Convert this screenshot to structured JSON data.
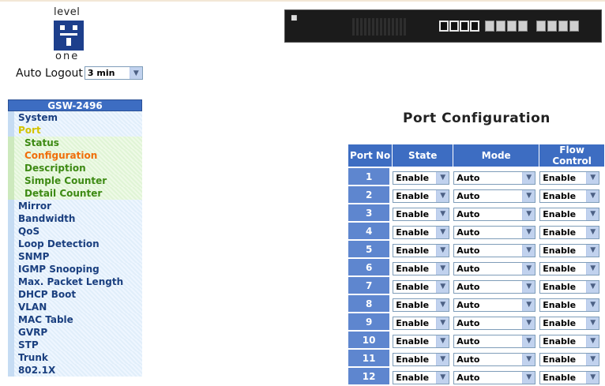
{
  "logo": {
    "top_text": "level",
    "bottom_text": "one"
  },
  "auto_logout": {
    "label": "Auto Logout",
    "value": "3 min"
  },
  "menu": {
    "title": "GSW-2496",
    "items": [
      {
        "label": "System",
        "type": "top"
      },
      {
        "label": "Port",
        "type": "top",
        "active": true
      },
      {
        "label": "Status",
        "type": "sub"
      },
      {
        "label": "Configuration",
        "type": "sub",
        "current": true
      },
      {
        "label": "Description",
        "type": "sub"
      },
      {
        "label": "Simple Counter",
        "type": "sub"
      },
      {
        "label": "Detail Counter",
        "type": "sub"
      },
      {
        "label": "Mirror",
        "type": "top"
      },
      {
        "label": "Bandwidth",
        "type": "top"
      },
      {
        "label": "QoS",
        "type": "top"
      },
      {
        "label": "Loop Detection",
        "type": "top"
      },
      {
        "label": "SNMP",
        "type": "top"
      },
      {
        "label": "IGMP Snooping",
        "type": "top"
      },
      {
        "label": "Max. Packet Length",
        "type": "top"
      },
      {
        "label": "DHCP Boot",
        "type": "top"
      },
      {
        "label": "VLAN",
        "type": "top"
      },
      {
        "label": "MAC Table",
        "type": "top"
      },
      {
        "label": "GVRP",
        "type": "top"
      },
      {
        "label": "STP",
        "type": "top"
      },
      {
        "label": "Trunk",
        "type": "top"
      },
      {
        "label": "802.1X",
        "type": "top"
      }
    ]
  },
  "page": {
    "title": "Port Configuration"
  },
  "table": {
    "headers": [
      "Port No",
      "State",
      "Mode",
      "Flow Control"
    ],
    "rows": [
      {
        "port": "1",
        "state": "Enable",
        "mode": "Auto",
        "flow": "Enable"
      },
      {
        "port": "2",
        "state": "Enable",
        "mode": "Auto",
        "flow": "Enable"
      },
      {
        "port": "3",
        "state": "Enable",
        "mode": "Auto",
        "flow": "Enable"
      },
      {
        "port": "4",
        "state": "Enable",
        "mode": "Auto",
        "flow": "Enable"
      },
      {
        "port": "5",
        "state": "Enable",
        "mode": "Auto",
        "flow": "Enable"
      },
      {
        "port": "6",
        "state": "Enable",
        "mode": "Auto",
        "flow": "Enable"
      },
      {
        "port": "7",
        "state": "Enable",
        "mode": "Auto",
        "flow": "Enable"
      },
      {
        "port": "8",
        "state": "Enable",
        "mode": "Auto",
        "flow": "Enable"
      },
      {
        "port": "9",
        "state": "Enable",
        "mode": "Auto",
        "flow": "Enable"
      },
      {
        "port": "10",
        "state": "Enable",
        "mode": "Auto",
        "flow": "Enable"
      },
      {
        "port": "11",
        "state": "Enable",
        "mode": "Auto",
        "flow": "Enable"
      },
      {
        "port": "12",
        "state": "Enable",
        "mode": "Auto",
        "flow": "Enable"
      }
    ]
  },
  "colors": {
    "header_blue": "#3d6dc2",
    "port_cell_blue": "#5e86cf",
    "submenu_green": "#3d8a13",
    "current_orange": "#f06e0a"
  },
  "icons": {
    "dropdown": "chevron-down-icon",
    "logo": "levelone-logo-icon",
    "switch": "switch-front-panel-icon"
  }
}
